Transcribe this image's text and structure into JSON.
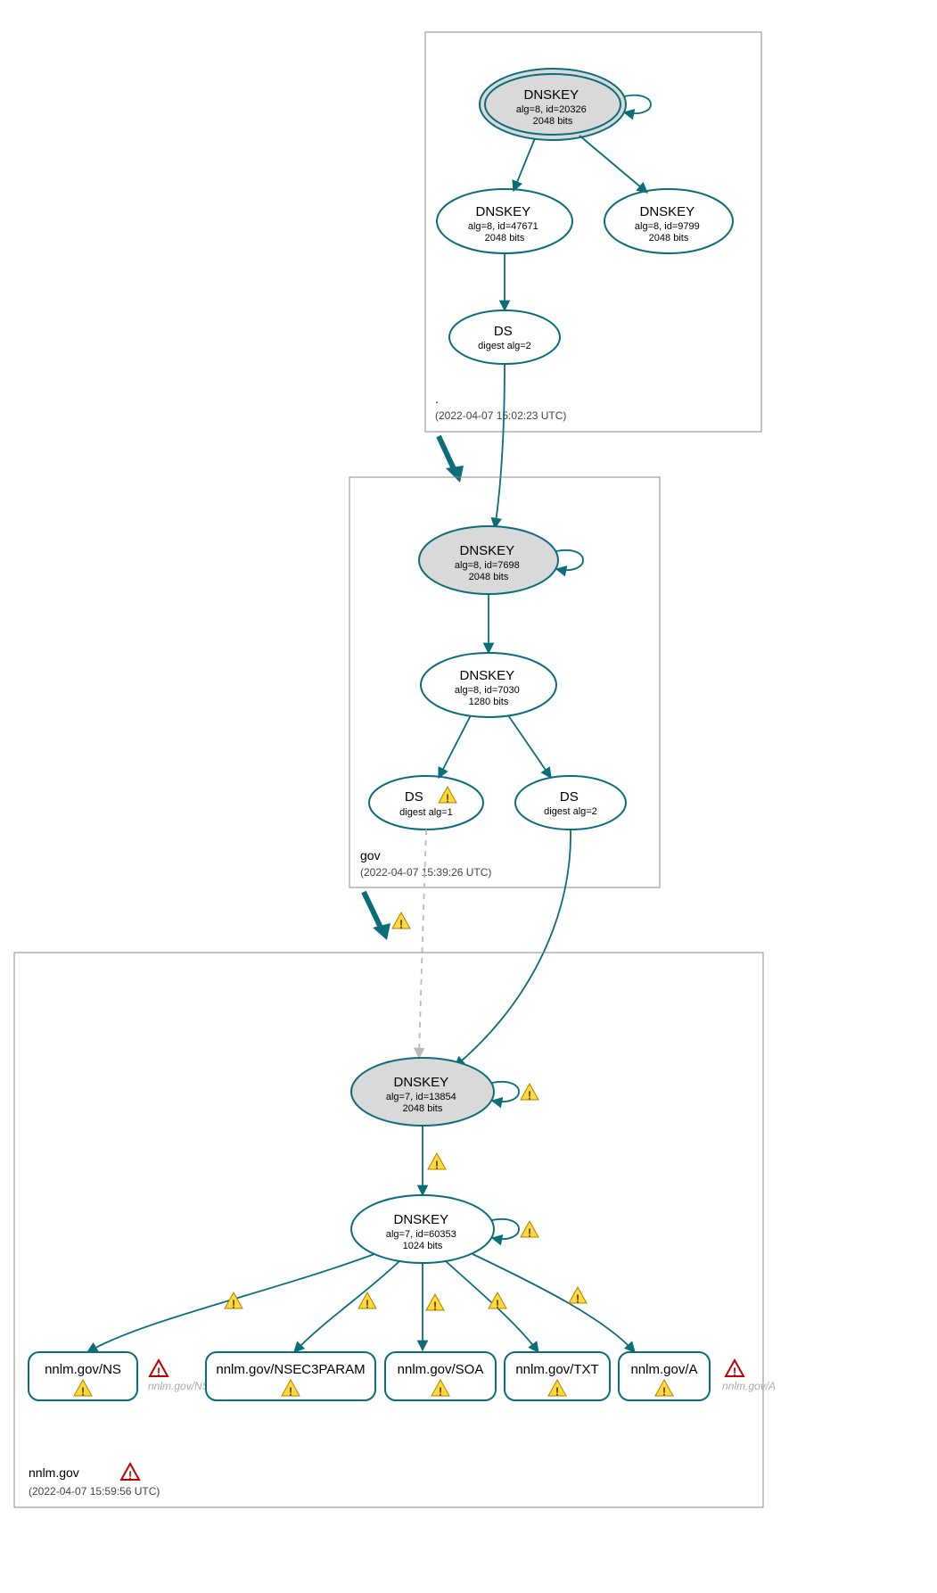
{
  "zones": {
    "root": {
      "label": ".",
      "timestamp": "(2022-04-07 15:02:23 UTC)",
      "nodes": {
        "ksk": {
          "title": "DNSKEY",
          "sub1": "alg=8, id=20326",
          "sub2": "2048 bits"
        },
        "zsk1": {
          "title": "DNSKEY",
          "sub1": "alg=8, id=47671",
          "sub2": "2048 bits"
        },
        "zsk2": {
          "title": "DNSKEY",
          "sub1": "alg=8, id=9799",
          "sub2": "2048 bits"
        },
        "ds": {
          "title": "DS",
          "sub1": "digest alg=2"
        }
      }
    },
    "gov": {
      "label": "gov",
      "timestamp": "(2022-04-07 15:39:26 UTC)",
      "nodes": {
        "ksk": {
          "title": "DNSKEY",
          "sub1": "alg=8, id=7698",
          "sub2": "2048 bits"
        },
        "zsk": {
          "title": "DNSKEY",
          "sub1": "alg=8, id=7030",
          "sub2": "1280 bits"
        },
        "ds1": {
          "title": "DS",
          "sub1": "digest alg=1"
        },
        "ds2": {
          "title": "DS",
          "sub1": "digest alg=2"
        }
      }
    },
    "nnlm": {
      "label": "nnlm.gov",
      "timestamp": "(2022-04-07 15:59:56 UTC)",
      "nodes": {
        "ksk": {
          "title": "DNSKEY",
          "sub1": "alg=7, id=13854",
          "sub2": "2048 bits"
        },
        "zsk": {
          "title": "DNSKEY",
          "sub1": "alg=7, id=60353",
          "sub2": "1024 bits"
        }
      },
      "rrsets": {
        "ns": "nnlm.gov/NS",
        "nsec3": "nnlm.gov/NSEC3PARAM",
        "soa": "nnlm.gov/SOA",
        "txt": "nnlm.gov/TXT",
        "a": "nnlm.gov/A"
      },
      "ghosts": {
        "ns": "nnlm.gov/NS",
        "a": "nnlm.gov/A"
      }
    }
  }
}
